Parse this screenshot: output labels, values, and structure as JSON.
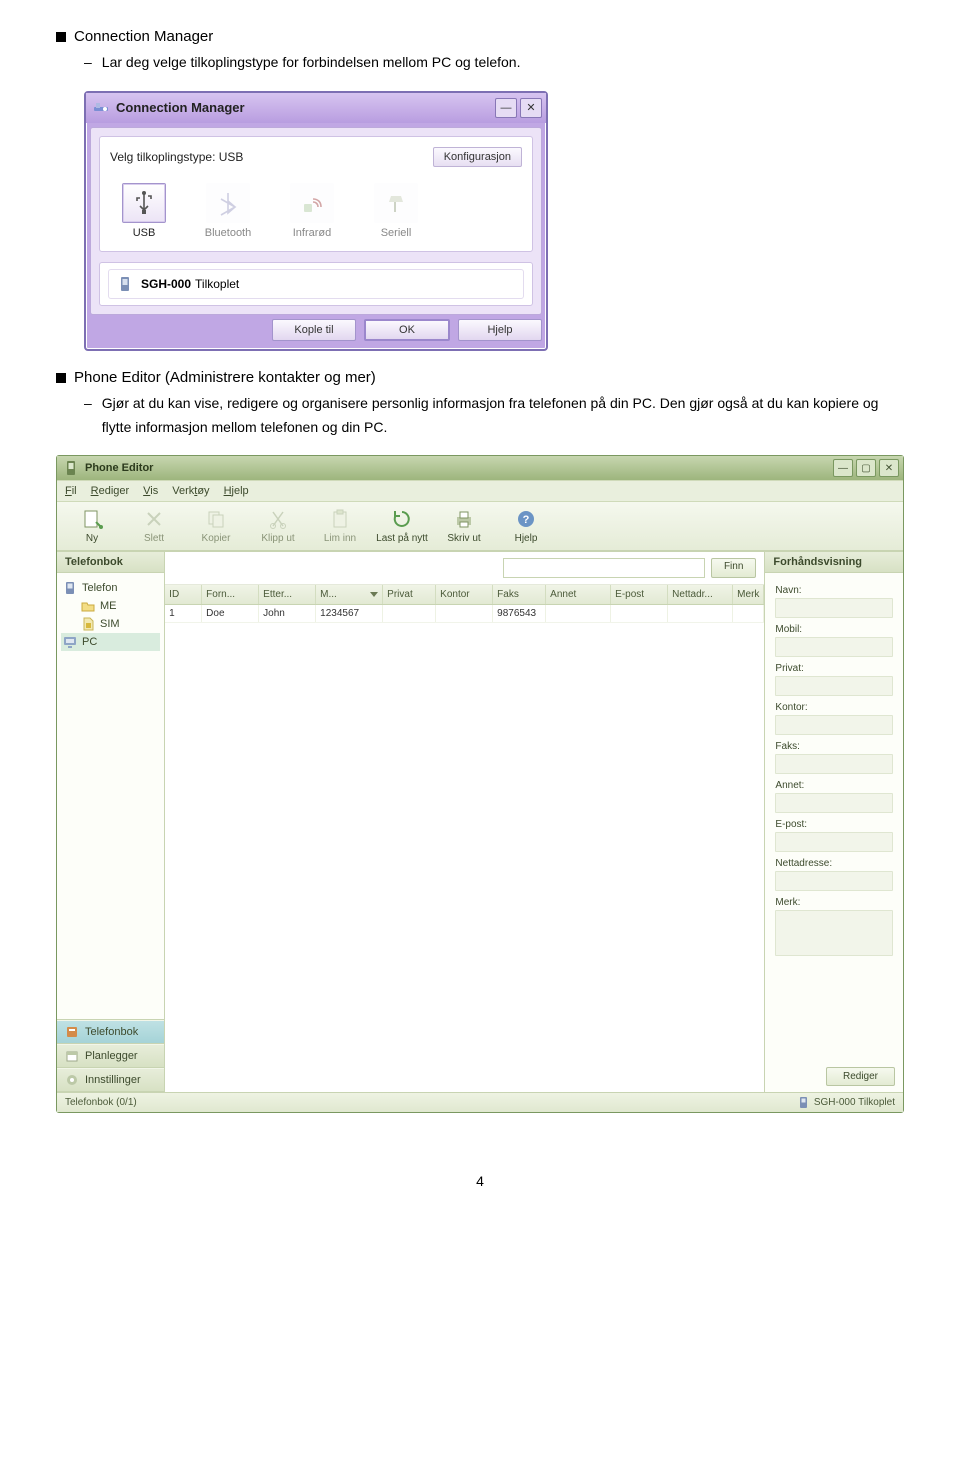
{
  "doc": {
    "section1_title": "Connection Manager",
    "section1_desc": "Lar deg velge tilkoplingstype for forbindelsen mellom PC og telefon.",
    "section2_title": "Phone Editor (Administrere kontakter og mer)",
    "section2_desc": "Gjør at du kan vise, redigere og organisere personlig informasjon fra telefonen på din PC. Den gjør også at du kan kopiere og flytte informasjon mellom telefonen og din PC.",
    "page_number": "4"
  },
  "cm": {
    "title": "Connection Manager",
    "select_label": "Velg tilkoplingstype: USB",
    "config_btn": "Konfigurasjon",
    "types": [
      {
        "label": "USB",
        "active": true
      },
      {
        "label": "Bluetooth",
        "active": false
      },
      {
        "label": "Infrarød",
        "active": false
      },
      {
        "label": "Seriell",
        "active": false
      }
    ],
    "status_device": "SGH-000",
    "status_text": "Tilkoplet",
    "buttons": {
      "connect": "Kople til",
      "ok": "OK",
      "help": "Hjelp"
    }
  },
  "pe": {
    "title": "Phone Editor",
    "menu": {
      "fil": "Fil",
      "rediger": "Rediger",
      "vis": "Vis",
      "verktoy": "Verktøy",
      "hjelp": "Hjelp"
    },
    "toolbar": [
      {
        "label": "Ny",
        "active": true
      },
      {
        "label": "Slett",
        "active": false
      },
      {
        "label": "Kopier",
        "active": false
      },
      {
        "label": "Klipp ut",
        "active": false
      },
      {
        "label": "Lim inn",
        "active": false
      },
      {
        "label": "Last på nytt",
        "active": true
      },
      {
        "label": "Skriv ut",
        "active": true
      },
      {
        "label": "Hjelp",
        "active": true
      }
    ],
    "left_header": "Telefonbok",
    "tree": {
      "telefon": "Telefon",
      "me": "ME",
      "sim": "SIM",
      "pc": "PC"
    },
    "nav": {
      "telefonbok": "Telefonbok",
      "planlegger": "Planlegger",
      "innstillinger": "Innstillinger"
    },
    "find_btn": "Finn",
    "grid_headers": [
      "ID",
      "Forn...",
      "Etter...",
      "M...",
      "Privat",
      "Kontor",
      "Faks",
      "Annet",
      "E-post",
      "Nettadr...",
      "Merk"
    ],
    "grid_row": {
      "id": "1",
      "forn": "Doe",
      "etter": "John",
      "m": "1234567",
      "privat": "",
      "kontor": "",
      "faks": "9876543",
      "annet": "",
      "epost": "",
      "nett": "",
      "merk": ""
    },
    "preview_header": "Forhåndsvisning",
    "preview_labels": {
      "navn": "Navn:",
      "mobil": "Mobil:",
      "privat": "Privat:",
      "kontor": "Kontor:",
      "faks": "Faks:",
      "annet": "Annet:",
      "epost": "E-post:",
      "nett": "Nettadresse:",
      "merk": "Merk:"
    },
    "edit_btn": "Rediger",
    "status_left": "Telefonbok (0/1)",
    "status_right": "SGH-000 Tilkoplet"
  }
}
